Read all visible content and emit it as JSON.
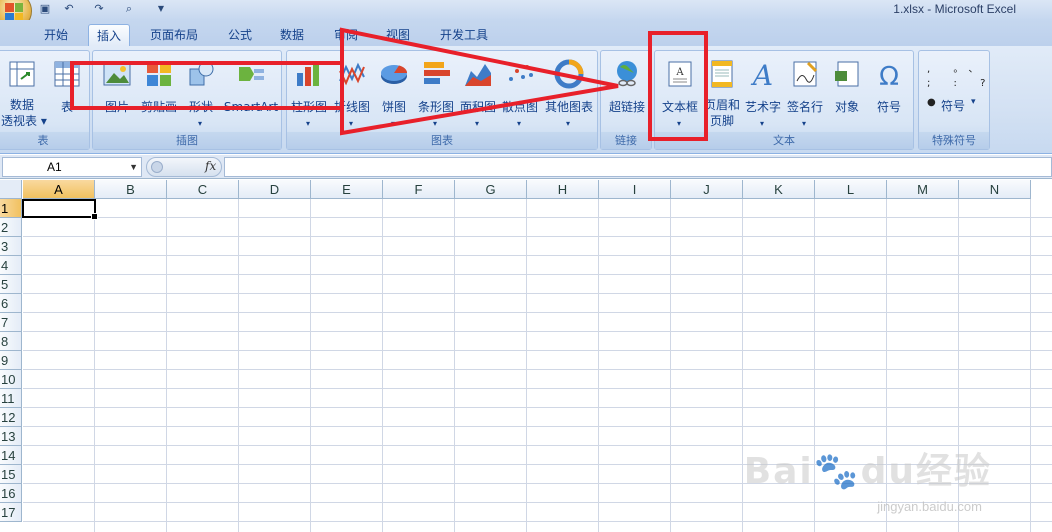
{
  "window": {
    "title": "1.xlsx - Microsoft Excel"
  },
  "tabs": [
    "开始",
    "插入",
    "页面布局",
    "公式",
    "数据",
    "审阅",
    "视图",
    "开发工具"
  ],
  "active_tab": "插入",
  "ribbon": {
    "groups": {
      "tables": {
        "label": "表",
        "buttons": [
          "数据透视表",
          "表"
        ]
      },
      "illustrations": {
        "label": "插图",
        "buttons": [
          "图片",
          "剪贴画",
          "形状",
          "SmartArt"
        ]
      },
      "charts": {
        "label": "图表",
        "buttons": [
          "柱形图",
          "折线图",
          "饼图",
          "条形图",
          "面积图",
          "散点图",
          "其他图表"
        ]
      },
      "links": {
        "label": "链接",
        "buttons": [
          "超链接"
        ]
      },
      "text": {
        "label": "文本",
        "buttons": [
          "文本框",
          "页眉和页脚",
          "艺术字",
          "签名行",
          "对象",
          "符号"
        ]
      },
      "special": {
        "label": "特殊符号",
        "buttons": [
          "符号"
        ]
      }
    }
  },
  "formula_bar": {
    "name_box": "A1",
    "fx": "fx",
    "content": ""
  },
  "columns": [
    "A",
    "B",
    "C",
    "D",
    "E",
    "F",
    "G",
    "H",
    "I",
    "J",
    "K",
    "L",
    "M",
    "N"
  ],
  "rows": [
    "1",
    "2",
    "3",
    "4",
    "5",
    "6",
    "7",
    "8",
    "9",
    "10",
    "11",
    "12",
    "13",
    "14",
    "15",
    "16",
    "17"
  ],
  "selected_cell": "A1",
  "watermark": {
    "brand": "Baidu经验",
    "url": "jingyan.baidu.com"
  },
  "colors": {
    "annotation": "#e8202a",
    "ribbon": "#d3e1f3",
    "selection": "#f1c15f"
  }
}
